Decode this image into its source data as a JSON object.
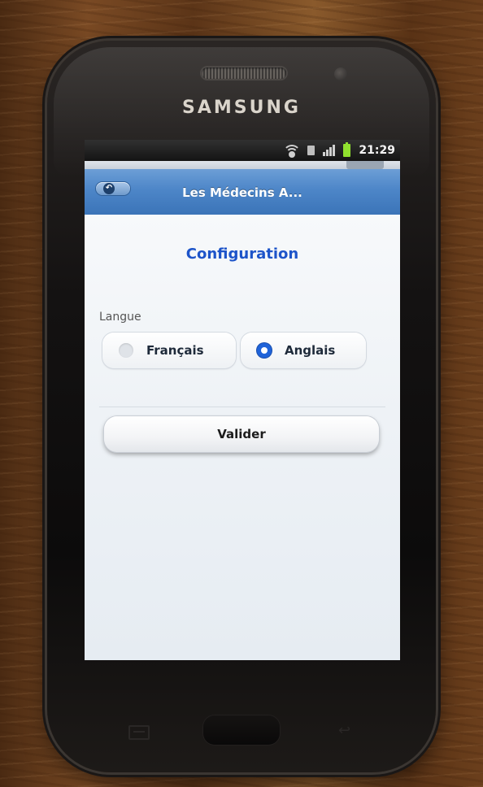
{
  "device": {
    "brand": "SAMSUNG"
  },
  "statusbar": {
    "time": "21:29",
    "icons": [
      "wifi-icon",
      "sd-card-icon",
      "signal-icon",
      "battery-icon"
    ]
  },
  "header": {
    "back_icon": "back-icon",
    "title": "Les Médecins A..."
  },
  "page": {
    "title": "Configuration"
  },
  "form": {
    "language_label": "Langue",
    "options": [
      {
        "label": "Français",
        "selected": false
      },
      {
        "label": "Anglais",
        "selected": true
      }
    ],
    "submit_label": "Valider"
  },
  "colors": {
    "header_blue": "#4d86c8",
    "title_blue": "#1d54c9",
    "radio_selected": "#1f63d9",
    "battery_green": "#8ee02a"
  }
}
